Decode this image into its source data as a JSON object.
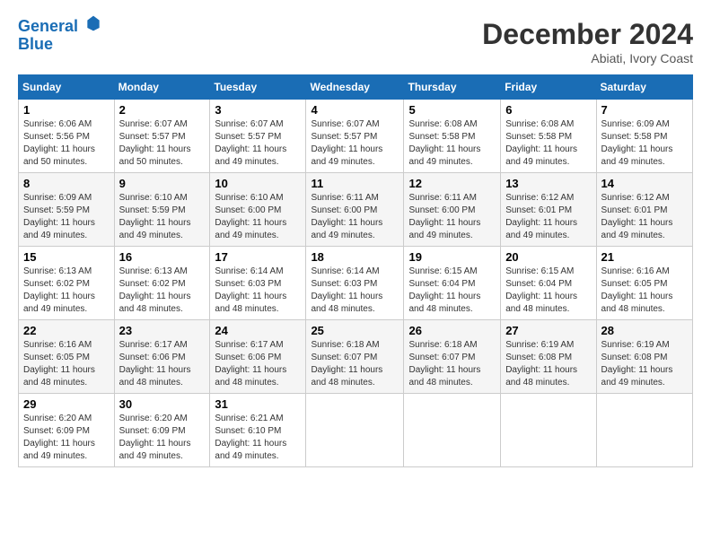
{
  "header": {
    "logo_line1": "General",
    "logo_line2": "Blue",
    "month_title": "December 2024",
    "location": "Abiati, Ivory Coast"
  },
  "weekdays": [
    "Sunday",
    "Monday",
    "Tuesday",
    "Wednesday",
    "Thursday",
    "Friday",
    "Saturday"
  ],
  "weeks": [
    [
      {
        "day": "1",
        "sunrise": "6:06 AM",
        "sunset": "5:56 PM",
        "daylight": "11 hours and 50 minutes."
      },
      {
        "day": "2",
        "sunrise": "6:07 AM",
        "sunset": "5:57 PM",
        "daylight": "11 hours and 50 minutes."
      },
      {
        "day": "3",
        "sunrise": "6:07 AM",
        "sunset": "5:57 PM",
        "daylight": "11 hours and 49 minutes."
      },
      {
        "day": "4",
        "sunrise": "6:07 AM",
        "sunset": "5:57 PM",
        "daylight": "11 hours and 49 minutes."
      },
      {
        "day": "5",
        "sunrise": "6:08 AM",
        "sunset": "5:58 PM",
        "daylight": "11 hours and 49 minutes."
      },
      {
        "day": "6",
        "sunrise": "6:08 AM",
        "sunset": "5:58 PM",
        "daylight": "11 hours and 49 minutes."
      },
      {
        "day": "7",
        "sunrise": "6:09 AM",
        "sunset": "5:58 PM",
        "daylight": "11 hours and 49 minutes."
      }
    ],
    [
      {
        "day": "8",
        "sunrise": "6:09 AM",
        "sunset": "5:59 PM",
        "daylight": "11 hours and 49 minutes."
      },
      {
        "day": "9",
        "sunrise": "6:10 AM",
        "sunset": "5:59 PM",
        "daylight": "11 hours and 49 minutes."
      },
      {
        "day": "10",
        "sunrise": "6:10 AM",
        "sunset": "6:00 PM",
        "daylight": "11 hours and 49 minutes."
      },
      {
        "day": "11",
        "sunrise": "6:11 AM",
        "sunset": "6:00 PM",
        "daylight": "11 hours and 49 minutes."
      },
      {
        "day": "12",
        "sunrise": "6:11 AM",
        "sunset": "6:00 PM",
        "daylight": "11 hours and 49 minutes."
      },
      {
        "day": "13",
        "sunrise": "6:12 AM",
        "sunset": "6:01 PM",
        "daylight": "11 hours and 49 minutes."
      },
      {
        "day": "14",
        "sunrise": "6:12 AM",
        "sunset": "6:01 PM",
        "daylight": "11 hours and 49 minutes."
      }
    ],
    [
      {
        "day": "15",
        "sunrise": "6:13 AM",
        "sunset": "6:02 PM",
        "daylight": "11 hours and 49 minutes."
      },
      {
        "day": "16",
        "sunrise": "6:13 AM",
        "sunset": "6:02 PM",
        "daylight": "11 hours and 48 minutes."
      },
      {
        "day": "17",
        "sunrise": "6:14 AM",
        "sunset": "6:03 PM",
        "daylight": "11 hours and 48 minutes."
      },
      {
        "day": "18",
        "sunrise": "6:14 AM",
        "sunset": "6:03 PM",
        "daylight": "11 hours and 48 minutes."
      },
      {
        "day": "19",
        "sunrise": "6:15 AM",
        "sunset": "6:04 PM",
        "daylight": "11 hours and 48 minutes."
      },
      {
        "day": "20",
        "sunrise": "6:15 AM",
        "sunset": "6:04 PM",
        "daylight": "11 hours and 48 minutes."
      },
      {
        "day": "21",
        "sunrise": "6:16 AM",
        "sunset": "6:05 PM",
        "daylight": "11 hours and 48 minutes."
      }
    ],
    [
      {
        "day": "22",
        "sunrise": "6:16 AM",
        "sunset": "6:05 PM",
        "daylight": "11 hours and 48 minutes."
      },
      {
        "day": "23",
        "sunrise": "6:17 AM",
        "sunset": "6:06 PM",
        "daylight": "11 hours and 48 minutes."
      },
      {
        "day": "24",
        "sunrise": "6:17 AM",
        "sunset": "6:06 PM",
        "daylight": "11 hours and 48 minutes."
      },
      {
        "day": "25",
        "sunrise": "6:18 AM",
        "sunset": "6:07 PM",
        "daylight": "11 hours and 48 minutes."
      },
      {
        "day": "26",
        "sunrise": "6:18 AM",
        "sunset": "6:07 PM",
        "daylight": "11 hours and 48 minutes."
      },
      {
        "day": "27",
        "sunrise": "6:19 AM",
        "sunset": "6:08 PM",
        "daylight": "11 hours and 48 minutes."
      },
      {
        "day": "28",
        "sunrise": "6:19 AM",
        "sunset": "6:08 PM",
        "daylight": "11 hours and 49 minutes."
      }
    ],
    [
      {
        "day": "29",
        "sunrise": "6:20 AM",
        "sunset": "6:09 PM",
        "daylight": "11 hours and 49 minutes."
      },
      {
        "day": "30",
        "sunrise": "6:20 AM",
        "sunset": "6:09 PM",
        "daylight": "11 hours and 49 minutes."
      },
      {
        "day": "31",
        "sunrise": "6:21 AM",
        "sunset": "6:10 PM",
        "daylight": "11 hours and 49 minutes."
      },
      null,
      null,
      null,
      null
    ]
  ]
}
